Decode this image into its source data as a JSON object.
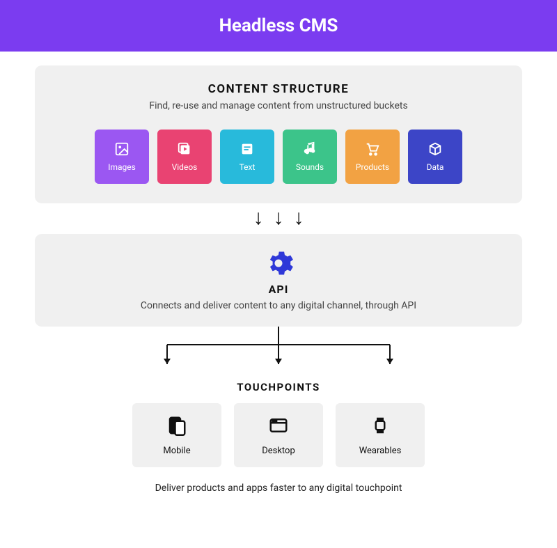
{
  "header": {
    "title": "Headless CMS"
  },
  "content_structure": {
    "title": "CONTENT STRUCTURE",
    "subtitle": "Find, re-use  and manage content from unstructured buckets",
    "tiles": [
      {
        "label": "Images",
        "icon": "image-icon",
        "color": "#9b57f2"
      },
      {
        "label": "Videos",
        "icon": "video-icon",
        "color": "#e94372"
      },
      {
        "label": "Text",
        "icon": "text-icon",
        "color": "#28badb"
      },
      {
        "label": "Sounds",
        "icon": "sound-icon",
        "color": "#3cc48a"
      },
      {
        "label": "Products",
        "icon": "cart-icon",
        "color": "#f2a243"
      },
      {
        "label": "Data",
        "icon": "box-icon",
        "color": "#3c45c7"
      }
    ]
  },
  "api": {
    "title": "API",
    "subtitle": "Connects and deliver content to any digital channel, through API",
    "icon": "gear-icon",
    "icon_color": "#2e38d8"
  },
  "touchpoints": {
    "title": "TOUCHPOINTS",
    "subtitle": "Deliver products and apps faster to any digital touchpoint",
    "tiles": [
      {
        "label": "Mobile",
        "icon": "mobile-icon"
      },
      {
        "label": "Desktop",
        "icon": "desktop-icon"
      },
      {
        "label": "Wearables",
        "icon": "watch-icon"
      }
    ]
  }
}
